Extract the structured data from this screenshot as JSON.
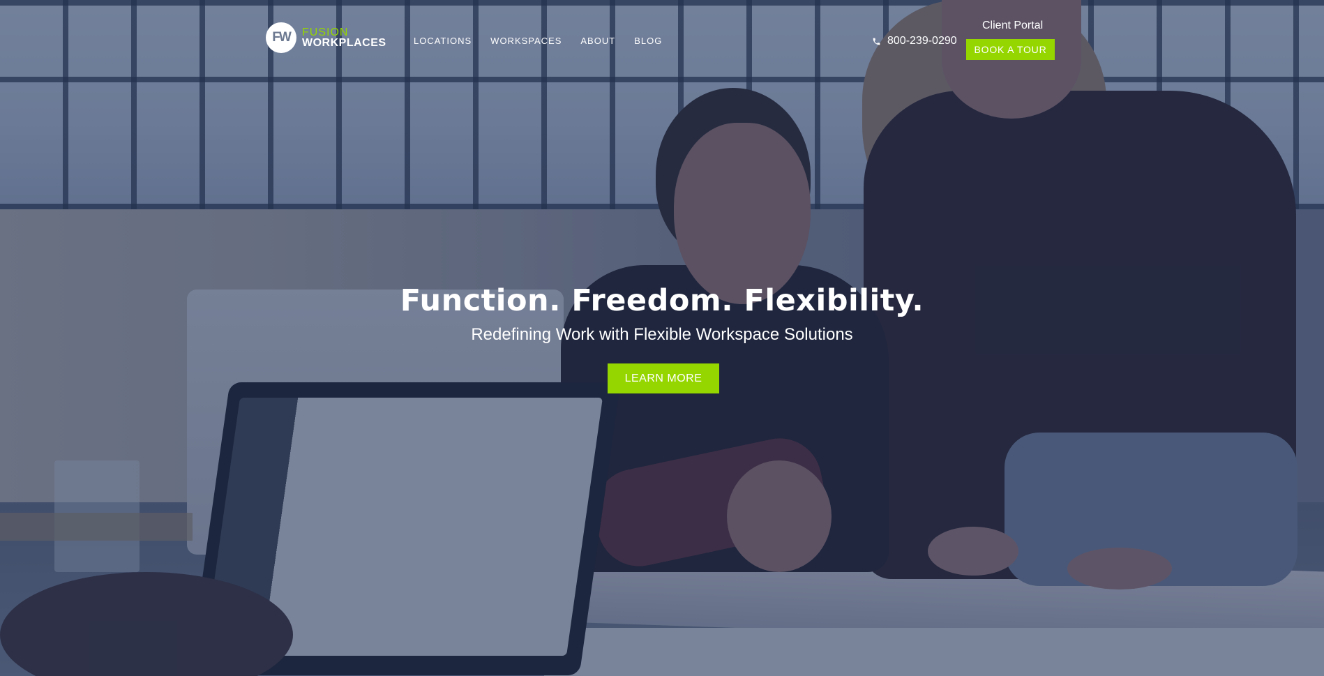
{
  "brand": {
    "logo_mark": "FW",
    "logo_line1": "FUSION",
    "logo_line2": "WORKPLACES",
    "accent_color": "#96d600"
  },
  "nav": {
    "items": [
      {
        "label": "LOCATIONS"
      },
      {
        "label": "WORKSPACES"
      },
      {
        "label": "ABOUT"
      },
      {
        "label": "BLOG"
      }
    ]
  },
  "header": {
    "phone_icon": "phone-icon",
    "phone": "800-239-0290",
    "client_portal": "Client Portal",
    "book_tour": "BOOK A TOUR"
  },
  "hero": {
    "title": "Function. Freedom. Flexibility.",
    "subtitle": "Redefining Work with Flexible Workspace Solutions",
    "cta": "LEARN MORE"
  }
}
